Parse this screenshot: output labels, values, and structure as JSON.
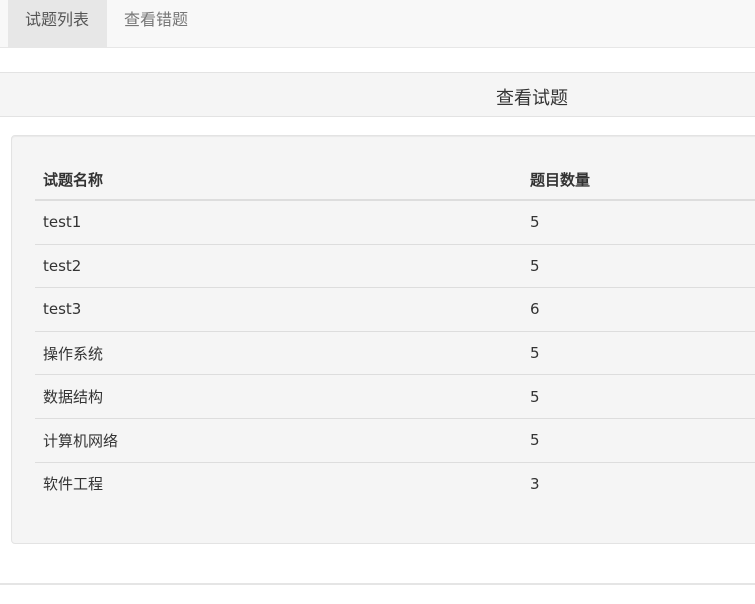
{
  "nav": {
    "tabs": [
      {
        "label": "试题列表",
        "active": true
      },
      {
        "label": "查看错题",
        "active": false
      }
    ]
  },
  "panel": {
    "title": "查看试题"
  },
  "table": {
    "headers": [
      "试题名称",
      "题目数量"
    ],
    "rows": [
      [
        "test1",
        "5"
      ],
      [
        "test2",
        "5"
      ],
      [
        "test3",
        "6"
      ],
      [
        "操作系统",
        "5"
      ],
      [
        "数据结构",
        "5"
      ],
      [
        "计算机网络",
        "5"
      ],
      [
        "软件工程",
        "3"
      ]
    ]
  },
  "colors": {
    "navbar_bg": "#f8f8f8",
    "active_tab_bg": "#e7e7e7",
    "well_bg": "#f5f5f5",
    "border": "#dddddd"
  }
}
